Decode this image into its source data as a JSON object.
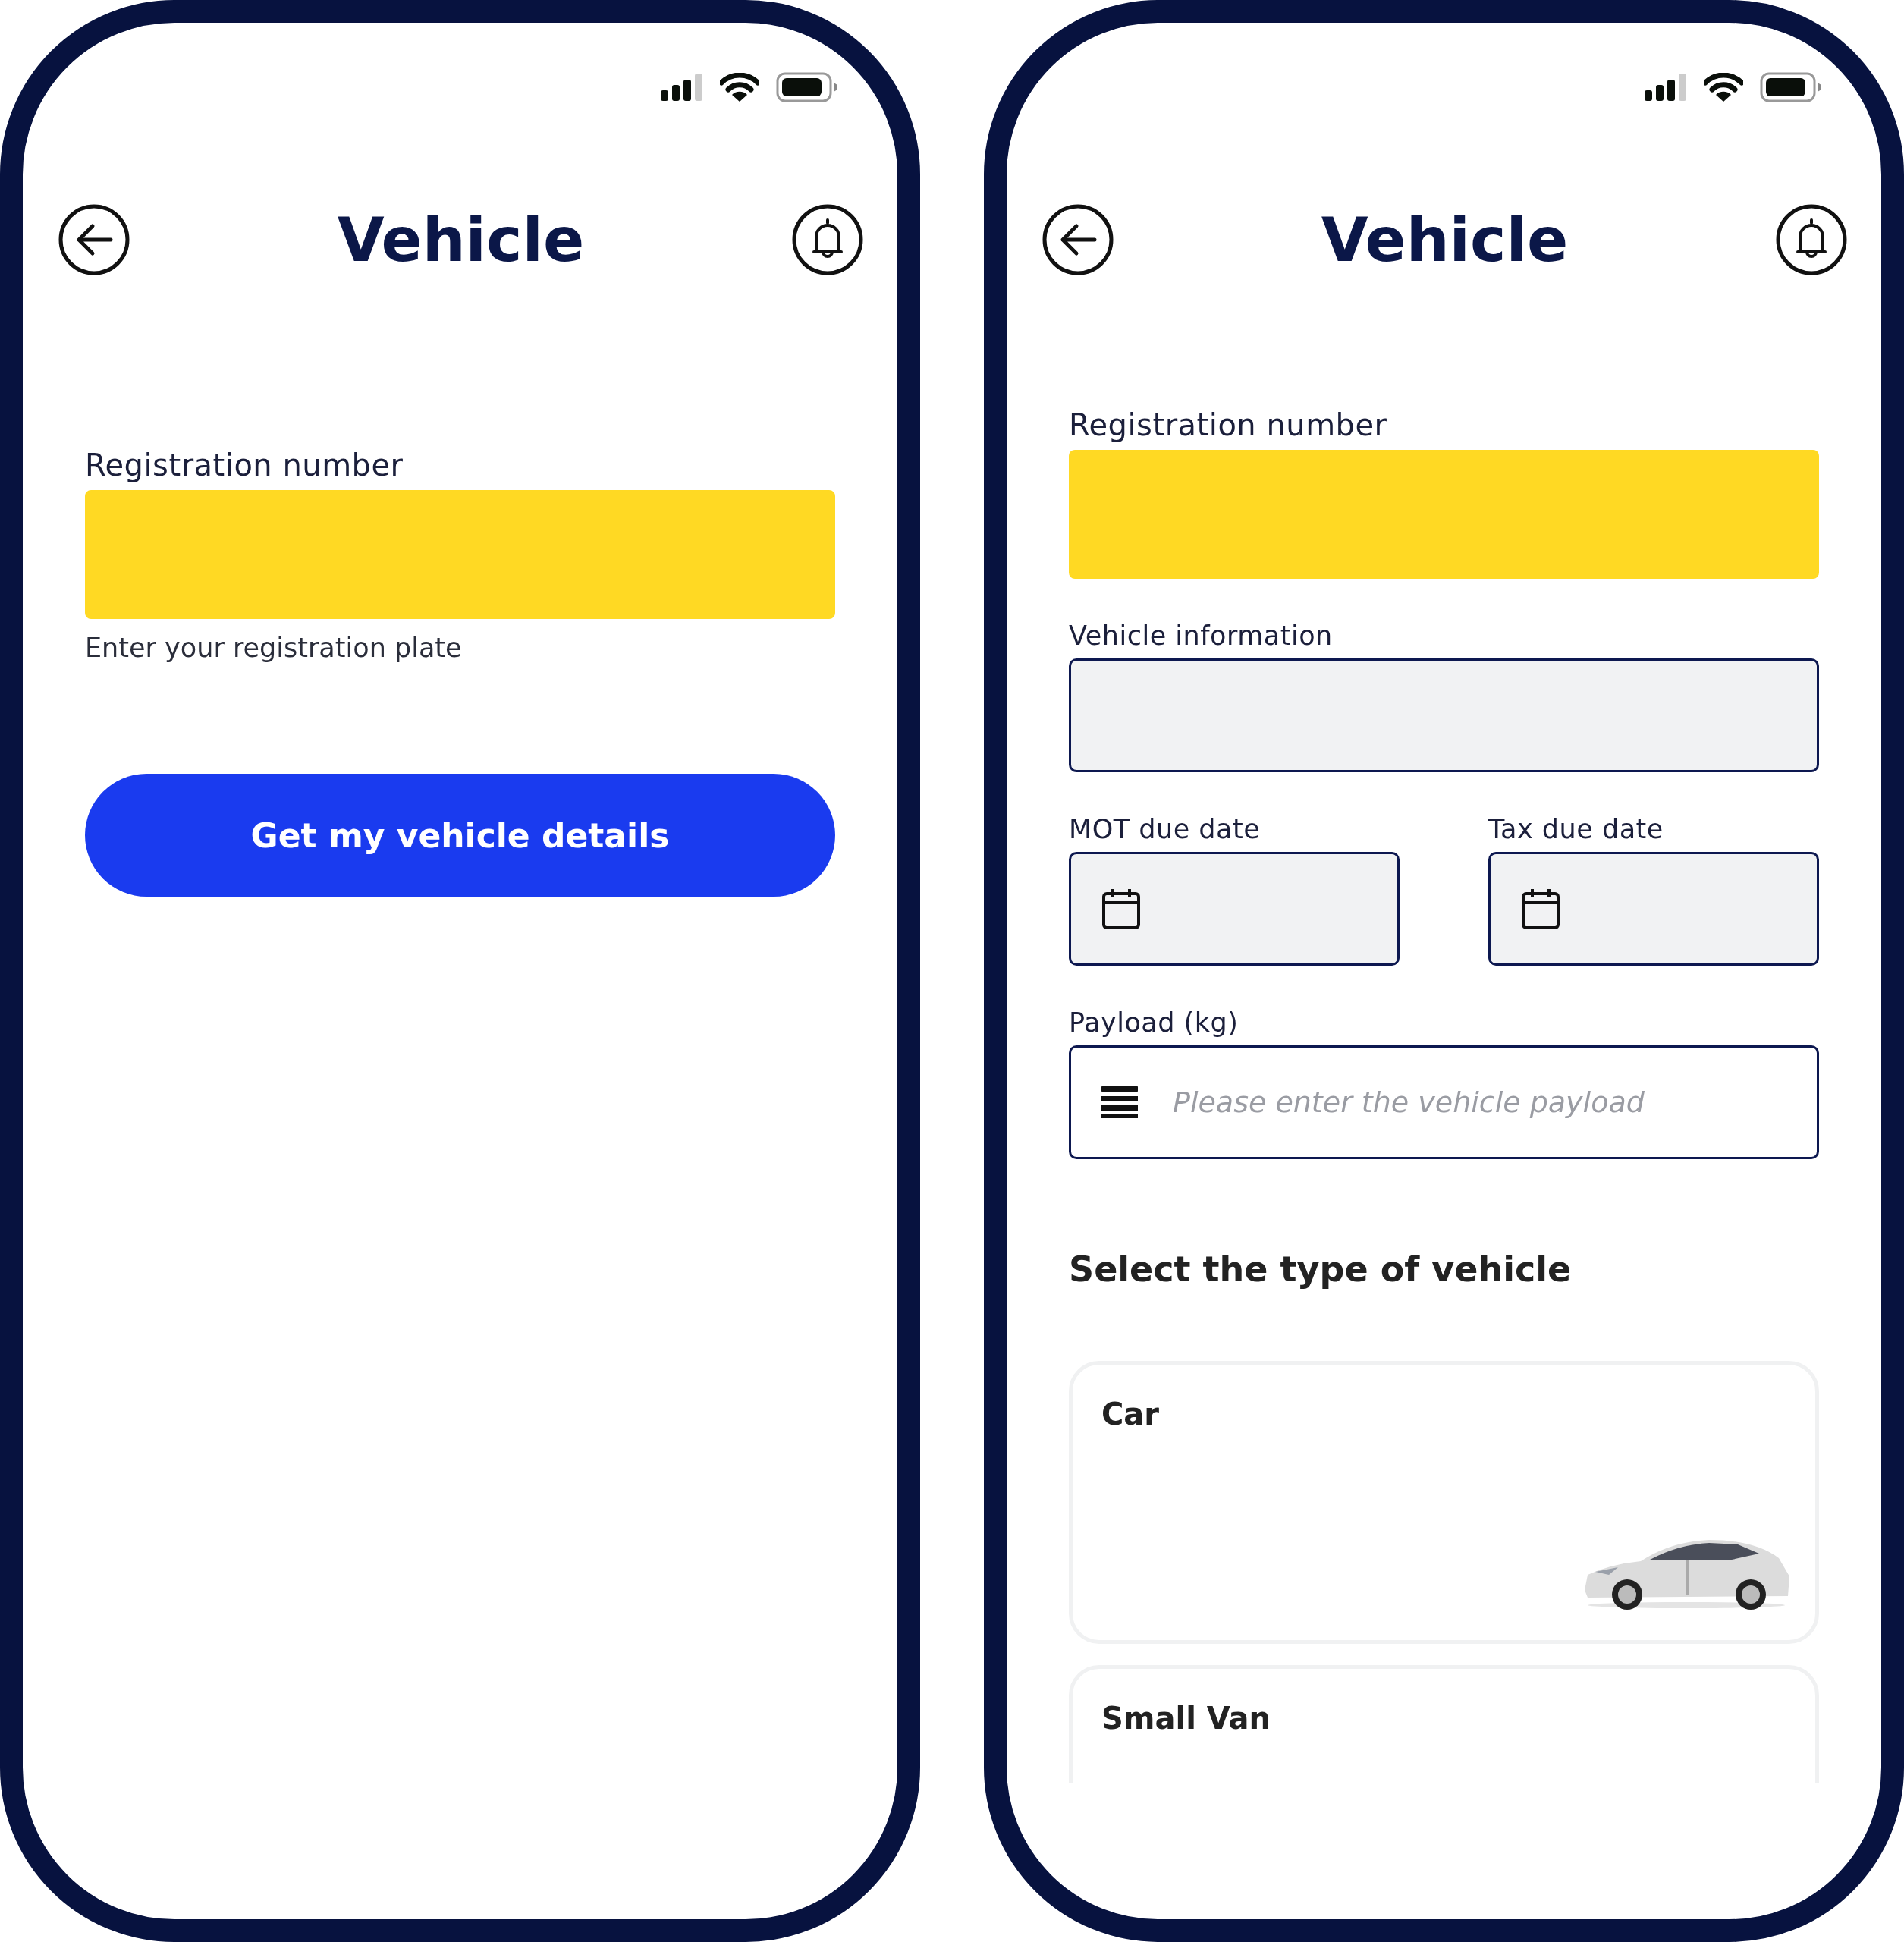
{
  "screens": [
    {
      "title": "Vehicle",
      "fields": [
        {
          "kind": "plate",
          "label": "Registration number",
          "helper": "Enter your registration plate"
        }
      ],
      "button": {
        "label": "Get my vehicle details"
      }
    },
    {
      "title": "Vehicle",
      "fields": [
        {
          "kind": "plate",
          "label": "Registration number"
        },
        {
          "kind": "box",
          "label": "Vehicle information"
        },
        {
          "kind": "date_pair",
          "items": [
            {
              "label": "MOT due date"
            },
            {
              "label": "Tax due date"
            }
          ]
        },
        {
          "kind": "payload",
          "label": "Payload (kg)",
          "placeholder": "Please enter the vehicle payload"
        }
      ],
      "section": {
        "title": "Select the type of vehicle",
        "options": [
          {
            "label": "Car",
            "kind": "picture"
          },
          {
            "label": "Small Van"
          }
        ]
      }
    }
  ]
}
